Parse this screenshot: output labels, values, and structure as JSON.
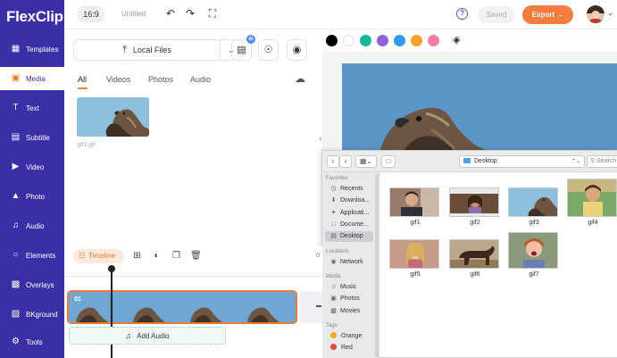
{
  "app": {
    "logo": "FlexClip"
  },
  "sidebar": {
    "items": [
      {
        "label": "Templates",
        "icon": "templates-icon"
      },
      {
        "label": "Media",
        "icon": "media-icon",
        "active": true
      },
      {
        "label": "Text",
        "icon": "text-icon"
      },
      {
        "label": "Subtitle",
        "icon": "subtitle-icon"
      },
      {
        "label": "Video",
        "icon": "video-icon"
      },
      {
        "label": "Photo",
        "icon": "photo-icon"
      },
      {
        "label": "Audio",
        "icon": "audio-icon"
      },
      {
        "label": "Elements",
        "icon": "elements-icon"
      },
      {
        "label": "Overlays",
        "icon": "overlays-icon"
      },
      {
        "label": "BKground",
        "icon": "background-icon"
      },
      {
        "label": "Tools",
        "icon": "tools-icon"
      }
    ]
  },
  "topbar": {
    "ratio": "16:9",
    "title": "Untitled",
    "saved_label": "Saved",
    "export_label": "Export →",
    "help_label": "?"
  },
  "media": {
    "local_files_label": "Local Files",
    "ai_badge": "AI",
    "tabs": [
      "All",
      "Videos",
      "Photos",
      "Audio"
    ],
    "active_tab": "All",
    "items": [
      {
        "name": "gif3.gif"
      }
    ]
  },
  "colors": {
    "swatches": [
      "#000000",
      "#ffffff",
      "#17b897",
      "#8a63dd",
      "#2f9bf2",
      "#f7a12b",
      "#f47ca6"
    ],
    "accent": "#f07a2f",
    "sidebar_bg": "#3b2fa8"
  },
  "finder": {
    "path": "Desktop",
    "search_placeholder": "Search",
    "sections": {
      "favorites": "Favorites",
      "locations": "Locations",
      "media": "Media",
      "tags": "Tags"
    },
    "favorites": [
      "Recents",
      "Downloa...",
      "Applicati...",
      "Docume...",
      "Desktop"
    ],
    "selected_favorite": "Desktop",
    "locations": [
      "Network"
    ],
    "media": [
      "Music",
      "Photos",
      "Movies"
    ],
    "tags": [
      {
        "label": "Orange",
        "color": "#f5a623"
      },
      {
        "label": "Red",
        "color": "#e74c3c"
      }
    ],
    "files": [
      "gif1",
      "gif2",
      "gif3",
      "gif4",
      "gif5",
      "gif6",
      "gif7"
    ]
  },
  "timeline": {
    "label": "Timeline",
    "time_marker": "0",
    "clip_number": "01",
    "add_audio_label": "Add Audio"
  }
}
